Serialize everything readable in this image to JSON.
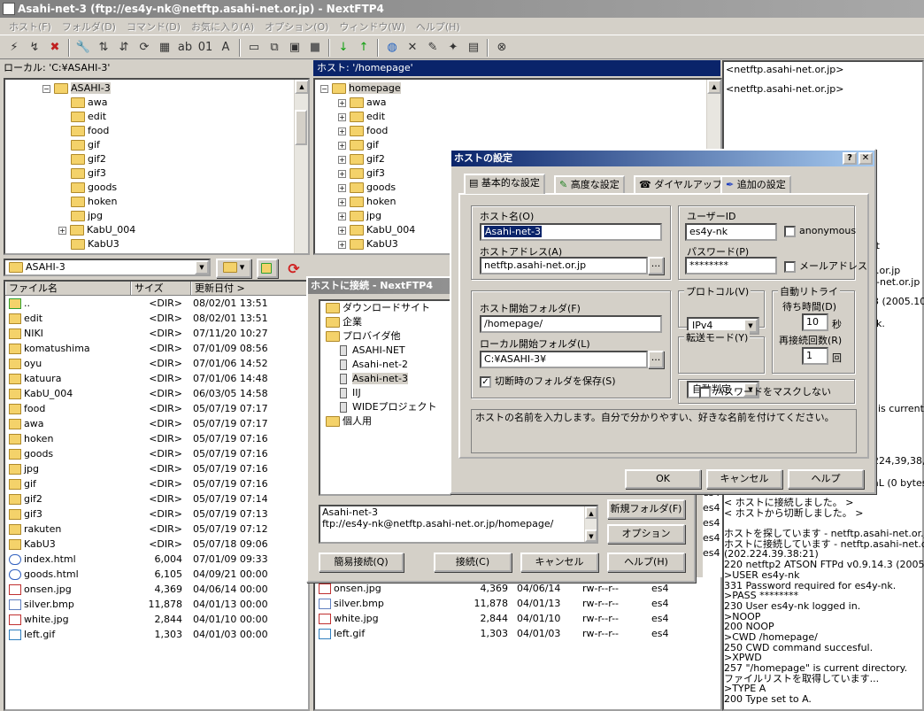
{
  "title": "Asahi-net-3 (ftp://es4y-nk@netftp.asahi-net.or.jp) - NextFTP4",
  "menu": [
    "ホスト(F)",
    "フォルダ(D)",
    "コマンド(D)",
    "お気に入り(A)",
    "オプション(O)",
    "ウィンドウ(W)",
    "ヘルプ(H)"
  ],
  "toolbar_icons": [
    "connect-icon",
    "reconnect-icon",
    "disconnect-icon",
    "tool-icon",
    "sort-asc-icon",
    "sort-desc-icon",
    "refresh-icon",
    "view-icon",
    "abc-icon",
    "bin-icon",
    "auto-icon",
    "folder-icon",
    "copy-icon",
    "move-icon",
    "stop-icon",
    "download-icon",
    "upload-icon",
    "globe-icon",
    "delete-icon",
    "rename-icon",
    "newfolder-icon",
    "attrib-icon",
    "close-icon"
  ],
  "local": {
    "header": "ローカル: 'C:¥ASAHI-3'",
    "tree_root": "ASAHI-3",
    "tree": [
      "awa",
      "edit",
      "food",
      "gif",
      "gif2",
      "gif3",
      "goods",
      "hoken",
      "jpg",
      "KabU_004",
      "KabU3"
    ],
    "path": "ASAHI-3",
    "columns": [
      "ファイル名",
      "サイズ",
      "更新日付 >"
    ],
    "files": [
      {
        "icon": "up",
        "name": "..",
        "size": "<DIR>",
        "date": "08/02/01 13:51"
      },
      {
        "icon": "folder",
        "name": "edit",
        "size": "<DIR>",
        "date": "08/02/01 13:51"
      },
      {
        "icon": "folder",
        "name": "NIKI",
        "size": "<DIR>",
        "date": "07/11/20 10:27"
      },
      {
        "icon": "folder",
        "name": "komatushima",
        "size": "<DIR>",
        "date": "07/01/09 08:56"
      },
      {
        "icon": "folder",
        "name": "oyu",
        "size": "<DIR>",
        "date": "07/01/06 14:52"
      },
      {
        "icon": "folder",
        "name": "katuura",
        "size": "<DIR>",
        "date": "07/01/06 14:48"
      },
      {
        "icon": "folder",
        "name": "KabU_004",
        "size": "<DIR>",
        "date": "06/03/05 14:58"
      },
      {
        "icon": "folder",
        "name": "food",
        "size": "<DIR>",
        "date": "05/07/19 07:17"
      },
      {
        "icon": "folder",
        "name": "awa",
        "size": "<DIR>",
        "date": "05/07/19 07:17"
      },
      {
        "icon": "folder",
        "name": "hoken",
        "size": "<DIR>",
        "date": "05/07/19 07:16"
      },
      {
        "icon": "folder",
        "name": "goods",
        "size": "<DIR>",
        "date": "05/07/19 07:16"
      },
      {
        "icon": "folder",
        "name": "jpg",
        "size": "<DIR>",
        "date": "05/07/19 07:16"
      },
      {
        "icon": "folder",
        "name": "gif",
        "size": "<DIR>",
        "date": "05/07/19 07:16"
      },
      {
        "icon": "folder",
        "name": "gif2",
        "size": "<DIR>",
        "date": "05/07/19 07:14"
      },
      {
        "icon": "folder",
        "name": "gif3",
        "size": "<DIR>",
        "date": "05/07/19 07:13"
      },
      {
        "icon": "folder",
        "name": "rakuten",
        "size": "<DIR>",
        "date": "05/07/19 07:12"
      },
      {
        "icon": "folder",
        "name": "KabU3",
        "size": "<DIR>",
        "date": "05/07/18 09:06"
      },
      {
        "icon": "html",
        "name": "index.html",
        "size": "6,004",
        "date": "07/01/09 09:33"
      },
      {
        "icon": "html",
        "name": "goods.html",
        "size": "6,105",
        "date": "04/09/21 00:00"
      },
      {
        "icon": "img",
        "name": "onsen.jpg",
        "size": "4,369",
        "date": "04/06/14 00:00"
      },
      {
        "icon": "bmp",
        "name": "silver.bmp",
        "size": "11,878",
        "date": "04/01/13 00:00"
      },
      {
        "icon": "img",
        "name": "white.jpg",
        "size": "2,844",
        "date": "04/01/10 00:00"
      },
      {
        "icon": "gif",
        "name": "left.gif",
        "size": "1,303",
        "date": "04/01/03 00:00"
      }
    ]
  },
  "remote": {
    "header": "ホスト: '/homepage'",
    "tree_root": "homepage",
    "tree": [
      "awa",
      "edit",
      "food",
      "gif",
      "gif2",
      "gif3",
      "goods",
      "hoken",
      "jpg",
      "KabU_004",
      "KabU3"
    ],
    "path": "homepage",
    "files": [
      {
        "icon": "img",
        "name": "onsen.jpg",
        "size": "4,369",
        "date": "04/06/14",
        "attr": "rw-r--r--",
        "owner": "es4"
      },
      {
        "icon": "bmp",
        "name": "silver.bmp",
        "size": "11,878",
        "date": "04/01/13",
        "attr": "rw-r--r--",
        "owner": "es4"
      },
      {
        "icon": "img",
        "name": "white.jpg",
        "size": "2,844",
        "date": "04/01/10",
        "attr": "rw-r--r--",
        "owner": "es4"
      },
      {
        "icon": "gif",
        "name": "left.gif",
        "size": "1,303",
        "date": "04/01/03",
        "attr": "rw-r--r--",
        "owner": "es4"
      }
    ],
    "owner_col": [
      "es4",
      "es4",
      "es4",
      "es4",
      "es4"
    ]
  },
  "log": {
    "top": [
      "<netftp.asahi-net.or.jp>",
      "<netftp.asahi-net.or.jp>"
    ],
    "partials": [
      "ft",
      ".or.jp",
      "-net.or.jp",
      "3 (2005.10",
      "k.",
      "is current",
      "224,39,38,1",
      "aL (0 bytes"
    ],
    "lines": [
      "< ホストに接続しました。 >",
      "< ホストから切断しました。 >",
      "",
      "ホストを探しています - netftp.asahi-net.or.jp",
      "ホストに接続しています - netftp.asahi-net.or.jp",
      "(202.224.39.38:21)",
      "220 netftp2 ATSON FTPd v0.9.14.3 (2005.10",
      "USER es4y-nk",
      "331 Password required for es4y-nk.",
      "PASS ********",
      "230 User es4y-nk logged in.",
      "NOOP",
      "200 NOOP",
      "CWD /homepage/",
      "250 CWD command succesful.",
      "XPWD",
      "257 \"/homepage\" is current directory.",
      "ファイルリストを取得しています...",
      "TYPE A",
      "200 Type set to A."
    ]
  },
  "connect_dialog": {
    "title": "ホストに接続 - NextFTP4",
    "tree": [
      {
        "label": "ダウンロードサイト",
        "level": 0,
        "type": "folder"
      },
      {
        "label": "企業",
        "level": 0,
        "type": "folder"
      },
      {
        "label": "プロバイダ他",
        "level": 0,
        "type": "folder"
      },
      {
        "label": "ASAHI-NET",
        "level": 1,
        "type": "host"
      },
      {
        "label": "Asahi-net-2",
        "level": 1,
        "type": "host"
      },
      {
        "label": "Asahi-net-3",
        "level": 1,
        "type": "host",
        "selected": true
      },
      {
        "label": "IIJ",
        "level": 1,
        "type": "host"
      },
      {
        "label": "WIDEプロジェクト",
        "level": 1,
        "type": "host"
      },
      {
        "label": "個人用",
        "level": 0,
        "type": "folder"
      }
    ],
    "info_line1": "Asahi-net-3",
    "info_line2": "ftp://es4y-nk@netftp.asahi-net.or.jp/homepage/",
    "btn_newfolder": "新規フォルダ(F)",
    "btn_option": "オプション",
    "btn_quick": "簡易接続(Q)",
    "btn_connect": "接続(C)",
    "btn_cancel": "キャンセル",
    "btn_help": "ヘルプ(H)"
  },
  "host_dialog": {
    "title": "ホストの設定",
    "tabs": [
      "基本的な設定",
      "高度な設定",
      "ダイヤルアップ",
      "追加の設定"
    ],
    "host_name_label": "ホスト名(O)",
    "host_name": "Asahi-net-3",
    "host_addr_label": "ホストアドレス(A)",
    "host_addr": "netftp.asahi-net.or.jp",
    "user_label": "ユーザーID",
    "user": "es4y-nk",
    "anon_label": "anonymous",
    "pass_label": "パスワード(P)",
    "pass": "********",
    "mailaddr_label": "メールアドレス",
    "host_folder_label": "ホスト開始フォルダ(F)",
    "host_folder": "/homepage/",
    "local_folder_label": "ローカル開始フォルダ(L)",
    "local_folder": "C:¥ASAHI-3¥",
    "save_folder_label": "切断時のフォルダを保存(S)",
    "protocol_label": "プロトコル(V)",
    "protocol": "IPv4",
    "transfer_label": "転送モード(Y)",
    "transfer": "自動判定",
    "retry_label": "自動リトライ",
    "wait_label": "待ち時間(D)",
    "wait": "10",
    "sec": "秒",
    "reconnect_label": "再接続回数(R)",
    "reconnect": "1",
    "times": "回",
    "mask_label": "パスワードをマスクしない",
    "hint": "ホストの名前を入力します。自分で分かりやすい、好きな名前を付けてください。",
    "ok": "OK",
    "cancel": "キャンセル",
    "help": "ヘルプ",
    "browse": "..."
  }
}
